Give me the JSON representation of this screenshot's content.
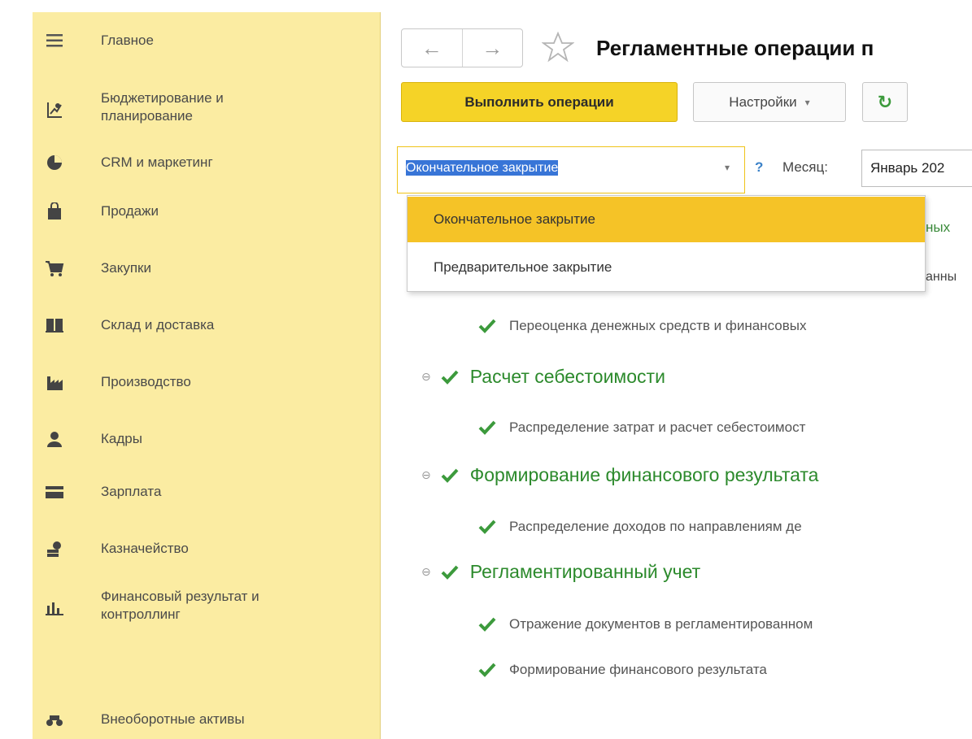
{
  "sidebar": {
    "items": [
      {
        "label": "Главное",
        "icon": "menu-icon"
      },
      {
        "label": "Бюджетирование и\nпланирование",
        "icon": "budget-icon"
      },
      {
        "label": "CRM и маркетинг",
        "icon": "crm-icon"
      },
      {
        "label": "Продажи",
        "icon": "sales-bag-icon"
      },
      {
        "label": "Закупки",
        "icon": "cart-icon"
      },
      {
        "label": "Склад и доставка",
        "icon": "warehouse-icon"
      },
      {
        "label": "Производство",
        "icon": "factory-icon"
      },
      {
        "label": "Кадры",
        "icon": "person-icon"
      },
      {
        "label": "Зарплата",
        "icon": "wallet-icon"
      },
      {
        "label": "Казначейство",
        "icon": "treasury-icon"
      },
      {
        "label": "Финансовый результат и\nконтроллинг",
        "icon": "bar-chart-icon"
      },
      {
        "label": "Внеоборотные активы",
        "icon": "assets-icon"
      }
    ]
  },
  "header": {
    "back_glyph": "←",
    "forward_glyph": "→",
    "title": "Регламентные операции п"
  },
  "toolbar": {
    "execute_label": "Выполнить операции",
    "settings_label": "Настройки",
    "settings_arrow": "▾",
    "refresh_glyph": "↻"
  },
  "filters": {
    "closing_type_value": "Окончательное закрытие",
    "combo_arrow": "▾",
    "help_glyph": "?",
    "month_label": "Месяц:",
    "month_value": "Январь 202"
  },
  "dropdown": {
    "options": [
      {
        "label": "Окончательное закрытие",
        "selected": true
      },
      {
        "label": "Предварительное закрытие",
        "selected": false
      }
    ]
  },
  "partially_hidden": {
    "line1": "ных",
    "line2": "анны"
  },
  "tree": {
    "expander_glyph": "⊖",
    "rows": [
      {
        "level": 2,
        "label": "Переоценка денежных средств и финансовых"
      },
      {
        "level": 1,
        "label": "Расчет себестоимости"
      },
      {
        "level": 2,
        "label": "Распределение затрат и расчет себестоимост"
      },
      {
        "level": 1,
        "label": "Формирование финансового результата"
      },
      {
        "level": 2,
        "label": "Распределение доходов по направлениям де"
      },
      {
        "level": 1,
        "label": "Регламентированный учет"
      },
      {
        "level": 2,
        "label": "Отражение документов в регламентированном"
      },
      {
        "level": 2,
        "label": "Формирование финансового результата"
      }
    ]
  },
  "colors": {
    "sidebar_bg": "#fbeca2",
    "primary_button": "#f5d327",
    "selected_option": "#f5c327",
    "check_green": "#3c9a3c"
  }
}
